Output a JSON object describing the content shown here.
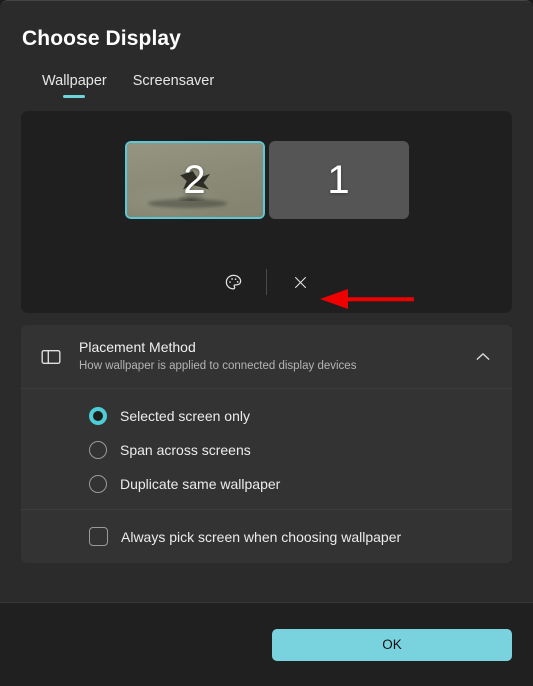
{
  "dialog": {
    "title": "Choose Display"
  },
  "tabs": [
    {
      "label": "Wallpaper",
      "active": true
    },
    {
      "label": "Screensaver",
      "active": false
    }
  ],
  "preview": {
    "monitors": [
      {
        "number": "2",
        "selected": true,
        "has_wallpaper": true
      },
      {
        "number": "1",
        "selected": false,
        "has_wallpaper": false
      }
    ],
    "tools": [
      {
        "name": "palette-icon",
        "label": "Choose color"
      },
      {
        "name": "close-icon",
        "label": "Remove wallpaper"
      }
    ]
  },
  "placement": {
    "icon": "dual-pane-icon",
    "title": "Placement Method",
    "subtitle": "How wallpaper is applied to connected display devices",
    "expand_icon": "chevron-up-icon",
    "options": [
      {
        "label": "Selected screen only",
        "checked": true
      },
      {
        "label": "Span across screens",
        "checked": false
      },
      {
        "label": "Duplicate same wallpaper",
        "checked": false
      }
    ],
    "checkbox": {
      "label": "Always pick screen when choosing wallpaper",
      "checked": false
    }
  },
  "footer": {
    "ok_label": "OK"
  },
  "annotation": {
    "arrow_color": "#ee0000",
    "points_to": "close-icon"
  },
  "colors": {
    "accent": "#6fd4dd",
    "ok_button": "#79d3de",
    "selection_border": "#5cc8d6",
    "dialog_bg": "#2b2b2b",
    "preview_bg": "#1f1f1f",
    "card_bg": "#333333",
    "footer_bg": "#202020"
  }
}
